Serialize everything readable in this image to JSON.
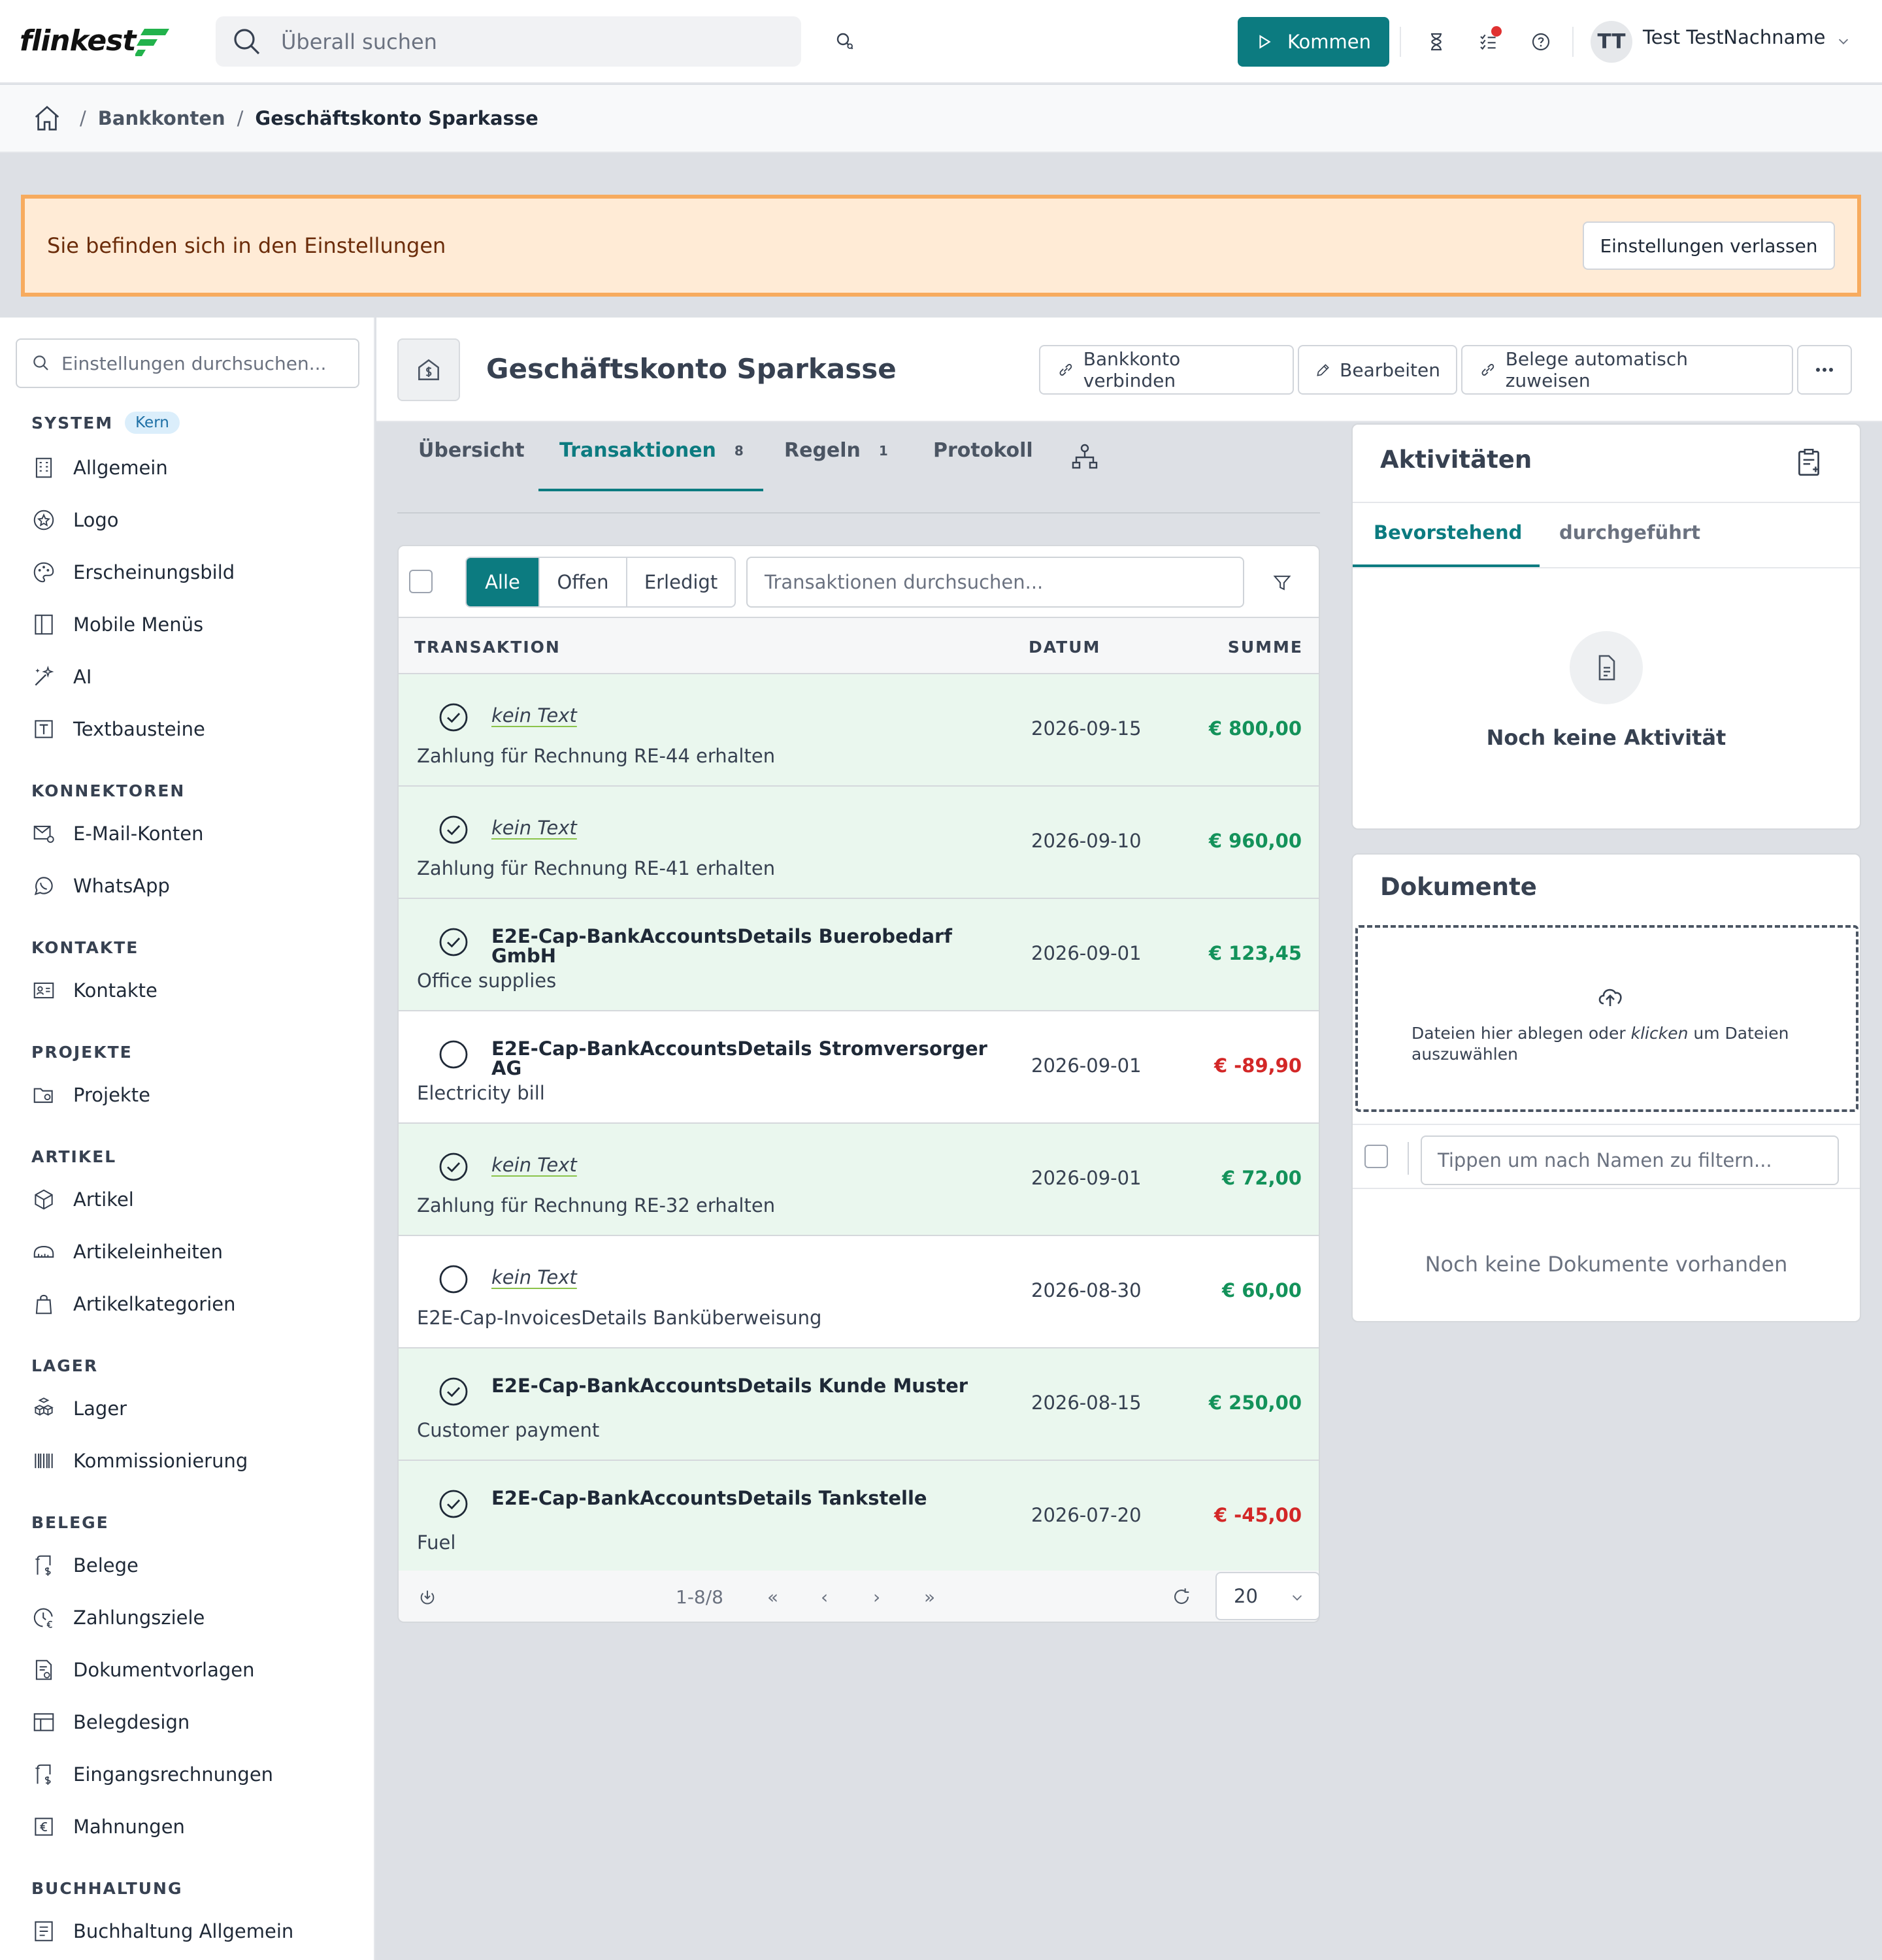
{
  "app": {
    "logo": "flinkest"
  },
  "topbar": {
    "search_placeholder": "Überall suchen",
    "kommen_label": "Kommen",
    "user_initials": "TT",
    "user_name": "Test TestNachname"
  },
  "breadcrumb": {
    "items": [
      "Bankkonten",
      "Geschäftskonto Sparkasse"
    ]
  },
  "banner": {
    "text": "Sie befinden sich in den Einstellungen",
    "button": "Einstellungen verlassen"
  },
  "sidebar": {
    "search_placeholder": "Einstellungen durchsuchen...",
    "sections": [
      {
        "title": "SYSTEM",
        "badge": "Kern",
        "items": [
          "Allgemein",
          "Logo",
          "Erscheinungsbild",
          "Mobile Menüs",
          "AI",
          "Textbausteine"
        ]
      },
      {
        "title": "KONNEKTOREN",
        "items": [
          "E-Mail-Konten",
          "WhatsApp"
        ]
      },
      {
        "title": "KONTAKTE",
        "items": [
          "Kontakte"
        ]
      },
      {
        "title": "PROJEKTE",
        "items": [
          "Projekte"
        ]
      },
      {
        "title": "ARTIKEL",
        "items": [
          "Artikel",
          "Artikeleinheiten",
          "Artikelkategorien"
        ]
      },
      {
        "title": "LAGER",
        "items": [
          "Lager",
          "Kommissionierung"
        ]
      },
      {
        "title": "BELEGE",
        "items": [
          "Belege",
          "Zahlungsziele",
          "Dokumentvorlagen",
          "Belegdesign",
          "Eingangsrechnungen",
          "Mahnungen"
        ]
      },
      {
        "title": "BUCHHALTUNG",
        "items": [
          "Buchhaltung Allgemein"
        ]
      }
    ]
  },
  "main": {
    "title": "Geschäftskonto Sparkasse",
    "actions": {
      "connect": "Bankkonto verbinden",
      "edit": "Bearbeiten",
      "assign": "Belege automatisch zuweisen"
    },
    "tabs": [
      {
        "label": "Übersicht",
        "count": ""
      },
      {
        "label": "Transaktionen",
        "count": "8"
      },
      {
        "label": "Regeln",
        "count": "1"
      },
      {
        "label": "Protokoll",
        "count": ""
      }
    ],
    "filter": {
      "all": "Alle",
      "open": "Offen",
      "done": "Erledigt",
      "search_placeholder": "Transaktionen durchsuchen..."
    },
    "table": {
      "headers": [
        "TRANSAKTION",
        "DATUM",
        "SUMME"
      ],
      "rows": [
        {
          "title": "kein Text",
          "italic": true,
          "subtitle": "Zahlung für Rechnung RE-44 erhalten",
          "date": "2026-09-15",
          "amount": "€ 800,00",
          "sign": "pos",
          "done": true
        },
        {
          "title": "kein Text",
          "italic": true,
          "subtitle": "Zahlung für Rechnung RE-41 erhalten",
          "date": "2026-09-10",
          "amount": "€ 960,00",
          "sign": "pos",
          "done": true
        },
        {
          "title": "E2E-Cap-BankAccountsDetails Buerobedarf GmbH",
          "italic": false,
          "subtitle": "Office supplies",
          "date": "2026-09-01",
          "amount": "€ 123,45",
          "sign": "pos",
          "done": true
        },
        {
          "title": "E2E-Cap-BankAccountsDetails Stromversorger AG",
          "italic": false,
          "subtitle": "Electricity bill",
          "date": "2026-09-01",
          "amount": "€ -89,90",
          "sign": "neg",
          "done": false
        },
        {
          "title": "kein Text",
          "italic": true,
          "subtitle": "Zahlung für Rechnung RE-32 erhalten",
          "date": "2026-09-01",
          "amount": "€ 72,00",
          "sign": "pos",
          "done": true
        },
        {
          "title": "kein Text",
          "italic": true,
          "subtitle": "E2E-Cap-InvoicesDetails Banküberweisung",
          "date": "2026-08-30",
          "amount": "€ 60,00",
          "sign": "pos",
          "done": false
        },
        {
          "title": "E2E-Cap-BankAccountsDetails Kunde Muster",
          "italic": false,
          "subtitle": "Customer payment",
          "date": "2026-08-15",
          "amount": "€ 250,00",
          "sign": "pos",
          "done": true
        },
        {
          "title": "E2E-Cap-BankAccountsDetails Tankstelle",
          "italic": false,
          "subtitle": "Fuel",
          "date": "2026-07-20",
          "amount": "€ -45,00",
          "sign": "neg",
          "done": true
        }
      ]
    },
    "pagination": {
      "range": "1-8/8",
      "first": "«",
      "prev": "‹",
      "next": "›",
      "last": "»",
      "page_size": "20"
    }
  },
  "activities": {
    "title": "Aktivitäten",
    "tab_upcoming": "Bevorstehend",
    "tab_done": "durchgeführt",
    "empty": "Noch keine Aktivität"
  },
  "documents": {
    "title": "Dokumente",
    "drop_before": "Dateien hier ablegen oder ",
    "drop_link": "klicken",
    "drop_after": " um Dateien auszuwählen",
    "filter_placeholder": "Tippen um nach Namen zu filtern...",
    "empty": "Noch keine Dokumente vorhanden"
  },
  "colors": {
    "accent": "#0c7b80",
    "positive": "#13925a",
    "negative": "#d32727",
    "row_done_bg": "#eaf7ee",
    "banner_bg": "#ffebd6",
    "banner_border": "#f7ab5e"
  }
}
